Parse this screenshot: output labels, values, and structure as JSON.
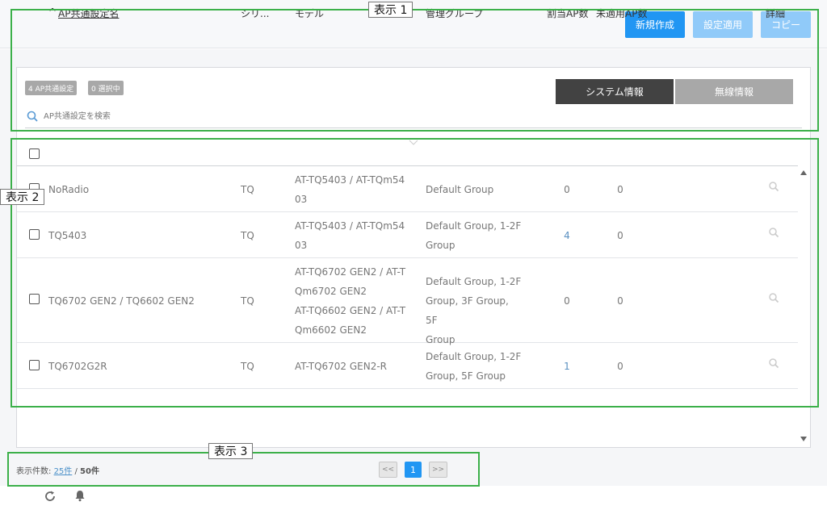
{
  "toolbar": {
    "new_label": "新規作成",
    "apply_label": "設定適用",
    "copy_label": "コピー"
  },
  "summary": {
    "count_badge": "4 AP共通設定",
    "selected_badge": "0 選択中"
  },
  "tabs": {
    "system": "システム情報",
    "wireless": "無線情報"
  },
  "search": {
    "placeholder": "AP共通設定を検索"
  },
  "table": {
    "headers": {
      "sort_indicator": "^",
      "name": "AP共通設定名",
      "series": "シリ...",
      "model": "モデル",
      "group": "管理グループ",
      "assigned": "割当AP数",
      "unapplied": "未適用AP数",
      "detail": "詳細"
    },
    "rows": [
      {
        "name": "NoRadio",
        "series": "TQ",
        "model": [
          "AT-TQ5403 / AT-TQm54",
          "03"
        ],
        "group": [
          "Default Group"
        ],
        "assigned": "0",
        "unapplied": "0"
      },
      {
        "name": "TQ5403",
        "series": "TQ",
        "model": [
          "AT-TQ5403 / AT-TQm54",
          "03"
        ],
        "group": [
          "Default Group, 1-2F",
          "Group"
        ],
        "assigned": "4",
        "unapplied": "0"
      },
      {
        "name": "TQ6702 GEN2 / TQ6602 GEN2",
        "series": "TQ",
        "model": [
          "AT-TQ6702 GEN2 / AT-T",
          "Qm6702 GEN2",
          "AT-TQ6602 GEN2 / AT-T",
          "Qm6602 GEN2"
        ],
        "group": [
          "Default Group, 1-2F",
          "Group, 3F Group, 5F",
          "Group"
        ],
        "assigned": "0",
        "unapplied": "0"
      },
      {
        "name": "TQ6702G2R",
        "series": "TQ",
        "model": [
          "AT-TQ6702 GEN2-R"
        ],
        "group": [
          "Default Group, 1-2F",
          "Group, 5F Group"
        ],
        "assigned": "1",
        "unapplied": "0"
      }
    ]
  },
  "footer": {
    "count_prefix": "表示件数:",
    "per_page": "25件",
    "separator": " / ",
    "total": "50件"
  },
  "pagination": {
    "prev": "<<",
    "current": "1",
    "next": ">>"
  },
  "annotations": {
    "label_1": "表示 1",
    "label_2": "表示 2",
    "label_3": "表示 3"
  },
  "colors": {
    "accent": "#2196f3",
    "accent_disabled": "#90caf9",
    "annotation": "#3cb04a",
    "tab_active": "#424242"
  }
}
